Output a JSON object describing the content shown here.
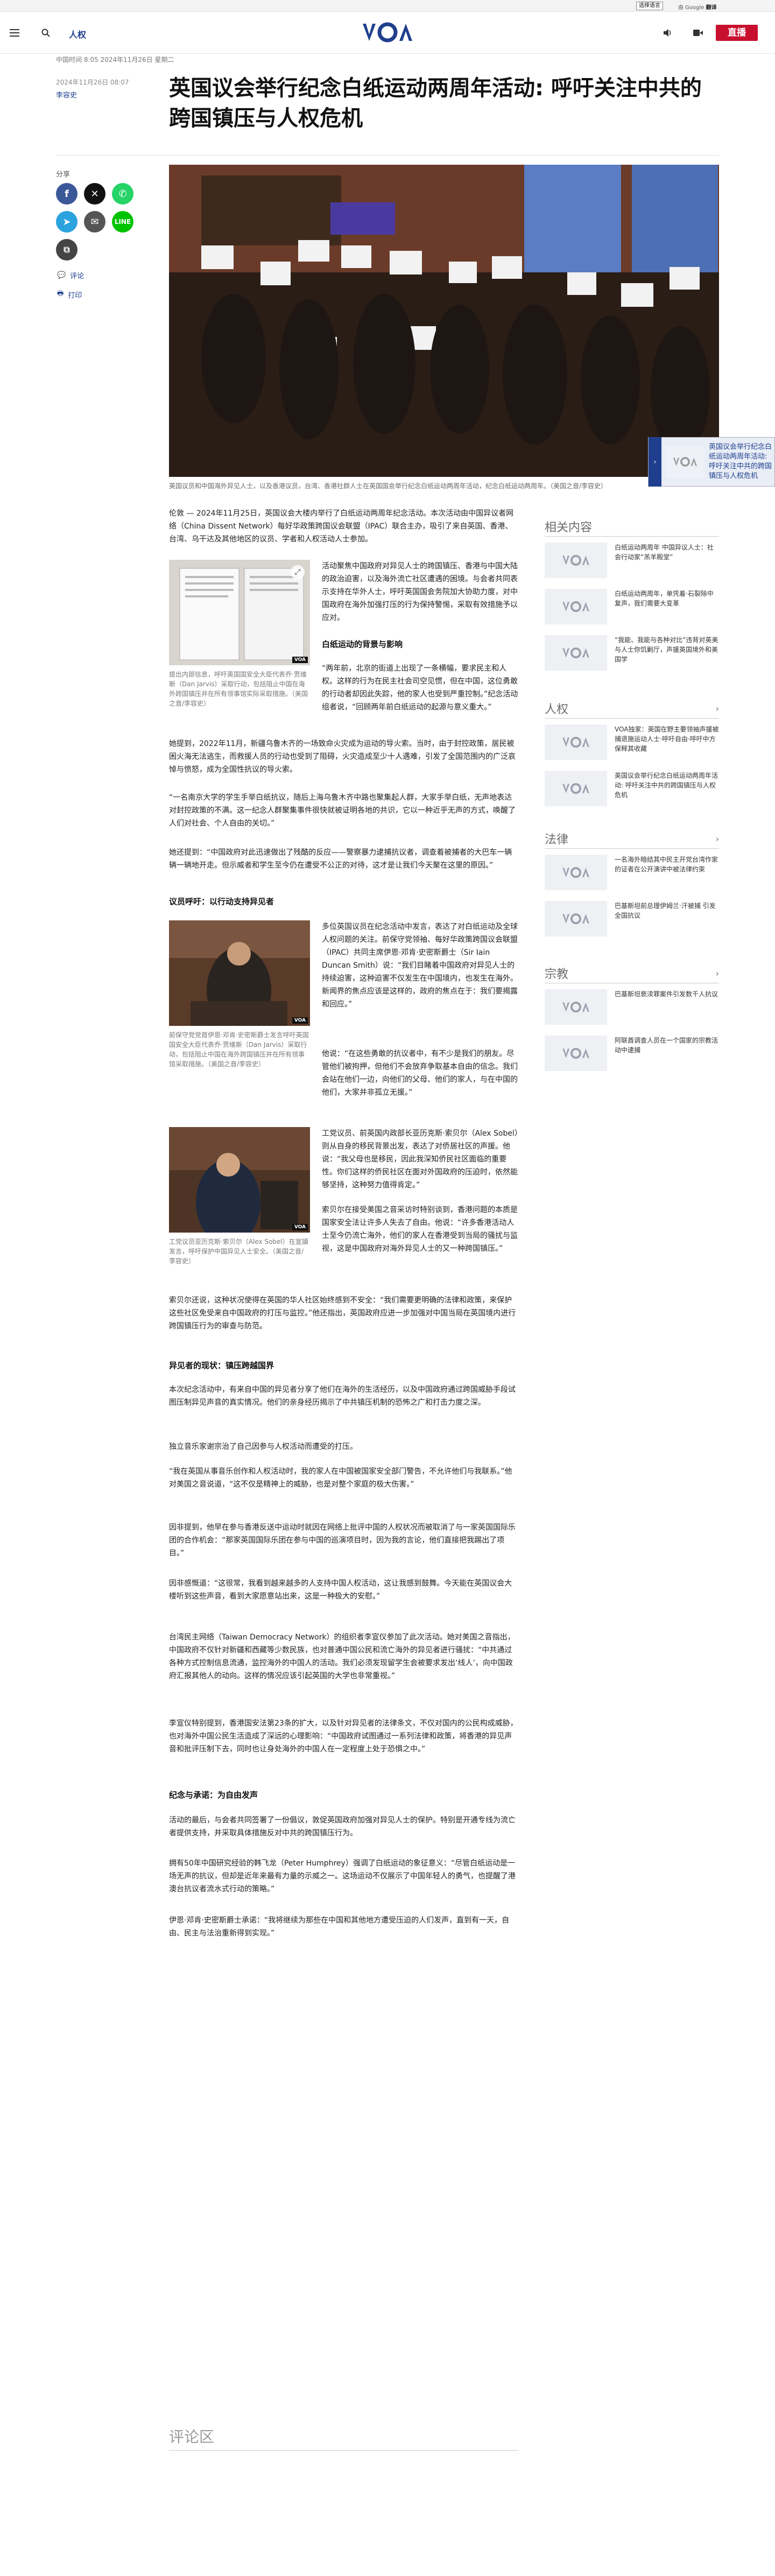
{
  "topbar": {
    "language_select": "选择语言",
    "powered_by": "由 Google",
    "translate": "翻译",
    "translate_suffix": "提供支持"
  },
  "header": {
    "nav_label": "人权",
    "logo_text": "VOA",
    "live_label": "直播",
    "live_color": "#c8102e"
  },
  "article": {
    "breadcrumb": "中国时间 8:05 2024年11月26日 星期二",
    "date": "2024年11月26日 08:07",
    "author": "李容史",
    "title": "英国议会举行纪念白纸运动两周年活动: 呼吁关注中共的跨国镇压与人权危机",
    "hero_caption": "英国议员和中国海外异见人士，以及香港议员，台湾、香港社群人士在英国国会举行纪念白纸运动两周年活动，纪念白纸运动两周年。（美国之音/李容史）",
    "share_label": "分享",
    "comment_link": "评论",
    "print_link": "打印",
    "paragraphs": [
      "伦敦 — 2024年11月25日，英国议会大楼内举行了白纸运动两周年纪念活动。本次活动由中国异议者网络（China Dissent Network）每好华政策跨国议会联盟（IPAC）联合主办，吸引了来自英国、香港、台湾、乌干达及其他地区的议员、学者和人权活动人士参加。",
      "活动聚焦中国政府对异见人士的跨国镇压、香港与中国大陆的政治迫害，以及海外流亡社区遭遇的困境。与会者共同表示支持在华外人士，呼吁英国国会务院加大协助力度，对中国政府在海外加强打压的行为保持警惕，采取有效措施予以应对。",
      "“两年前，北京的街道上出现了一条横幅，要求民主和人权。这样的行为在民主社会司空见惯，但在中国，这位勇敢的行动者却因此失踪，他的家人也受到严重控制。”纪念活动组者说，“回顾两年前白纸运动的起源与意义重大。”",
      "她提到，2022年11月，新疆乌鲁木齐的一场致命火灾成为运动的导火索。当时，由于封控政策，居民被困火海无法逃生，而救援人员的行动也受到了阻碍，火灾造成至少十人遇难，引发了全国范围内的广泛哀悼与愤怒，成为全国性抗议的导火索。",
      "“一名南京大学的学生手举白纸抗议，随后上海乌鲁木齐中路也聚集起人群，大家手举白纸，无声地表达对封控政策的不满。这一纪念人群聚集事件很快就被证明各地的共识，它以一种近乎无声的方式，唤醒了人们对社会、个人自由的关切。”",
      "她还提到：“中国政府对此迅速做出了残酷的反应——警察暴力逮捕抗议者，调查着被捕者的大巴车一辆辆一辆地开走。但示威者和学生至今仍在遭受不公正的对待，这才是让我们今天聚在这里的原因。”",
      "多位英国议员在纪念活动中发言，表达了对白纸运动及全球人权问题的关注。前保守党领袖、每好华政策跨国议会联盟（IPAC）共同主席伊恩·邓肯·史密斯爵士（Sir Iain Duncan Smith）说：“我们目睹着中国政府对异见人士的持续迫害，这种迫害不仅发生在中国境内，也发生在海外。新闻界的焦点应该是这样的，政府的焦点在于：我们要揭露和回应。”",
      "他说：“在这些勇敢的抗议者中，有不少是我们的朋友。尽管他们被拘押，但他们不会放弃争取基本自由的信念。我们会站在他们一边，向他们的父母、他们的家人，与在中国的他们，大家并非孤立无援。”",
      "工党议员、前英国内政部长亚历克斯·索贝尔（Alex Sobel）则从自身的移民背景出发，表达了对侨居社区的声援。他说：“我父母也是移民，因此我深知侨民社区面临的重要性。你们这样的侨民社区在面对外国政府的压迫时，依然能够坚持，这种努力值得肯定。”",
      "索贝尔在接受美国之音采访时特别谈到，香港问题的本质是国家安全法让许多人失去了自由。他说：“许多香港活动人士至今仍流亡海外，他们的家人在香港受到当局的骚扰与监视，这是中国政府对海外异见人士的又一种跨国镇压。”",
      "索贝尔还说，这种状况使得在英国的华人社区始终感到不安全：“我们需要更明确的法律和政策，来保护这些社区免受来自中国政府的打压与监控。”他还指出，英国政府应进一步加强对中国当局在英国境内进行跨国镇压行为的审查与防范。",
      "异见者的现状：镇压跨越国界",
      "本次纪念活动中，有来自中国的异见者分享了他们在海外的生活经历，以及中国政府通过跨国威胁手段试图压制异见声音的真实情况。他们的亲身经历揭示了中共镇压机制的恐怖之广和打击力度之深。",
      "独立音乐家谢宗治了自己因参与人权活动而遭受的打压。",
      "“我在英国从事音乐创作和人权活动时，我的家人在中国被国家安全部门警告，不允许他们与我联系。”他对美国之音说道，“这不仅是精神上的威胁，也是对整个家庭的极大伤害。”",
      "因非提到，他早在参与香港反送中运动时就因在网络上批评中国的人权状况而被取消了与一家英国国际乐团的合作机会：“那家英国国际乐团在参与中国的巡演项目时，因为我的言论，他们直接把我踢出了项目。”",
      "因非感慨道：“这很常，我看到越来越多的人支持中国人权活动，这让我感到鼓舞。今天能在英国议会大楼听到这些声音，看到大家愿意站出来，这是一种极大的安慰。”",
      "台湾民主网络（Taiwan Democracy Network）的组织者李宣仪参加了此次活动。她对美国之音指出，中国政府不仅针对新疆和西藏等少数民族，也对普通中国公民和流亡海外的异见者进行骚扰：“中共通过各种方式控制信息流通，监控海外的中国人的活动。我们必须发现留学生会被要求发出‘线人’，向中国政府汇报其他人的动向。这样的情况应该引起英国的大学也非常重视。”",
      "李宣仪特别提到，香港国安法第23条的扩大，以及针对异见者的法律条文，不仅对国内的公民构成威胁，也对海外中国公民生活造成了深远的心理影响：“中国政府试图通过一系列法律和政策，将香港的异见声音和批评压制下去，同时也让身处海外的中国人在一定程度上处于恐惧之中。”",
      "纪念与承诺：为自由发声",
      "活动的最后，与会者共同签署了一份倡议，敦促英国政府加强对异见人士的保护。特别是开通专线为流亡者提供支持，并采取具体措施反对中共的跨国镇压行为。",
      "拥有50年中国研究经验的韩飞龙（Peter Humphrey）强调了白纸运动的象征意义：“尽管白纸运动是一场无声的抗议，但却是近年来最有力量的示威之一。这场运动不仅展示了中国年轻人的勇气，也提醒了港澳台抗议者流水式行动的策略。”",
      "伊恩·邓肯·史密斯爵士承诺：“我将继续为那些在中国和其他地方遭受压迫的人们发声，直到有一天，自由、民主与法治重新得到实现。”"
    ],
    "subheads": [
      "白纸运动的背景与影响",
      "议员呼吁：以行动支持异见者"
    ],
    "inline_images": [
      {
        "caption": "提出内部信息，呼吁英国国安全大臣代表乔·贾维斯（Dan Jarvis）采取行动，包括阻止中国在海外跨国镇压并在所有领事馆实际采取措施。（美国之音/李容史）"
      },
      {
        "caption": "前保守党党首伊恩·邓肯·史密斯爵士发言呼吁英国国安全大臣代表乔·贾维斯（Dan Jarvis）采取行动，包括阻止中国在海外跨国镇压并在所有领事馆采取措施。（美国之音/李容史）"
      },
      {
        "caption": "工党议员亚历克斯·索贝尔（Alex Sobel）在宣讀发言，呼吁保护中国异见人士安全。（美国之音/李容史）"
      }
    ],
    "voa_tag": "VOA",
    "comments_heading": "评论区"
  },
  "floating_card": {
    "text": "英国议会举行纪念白纸运动两周年活动: 呼吁关注中共的跨国镇压与人权危机"
  },
  "rail": {
    "related_title": "相关内容",
    "related": [
      "白纸运动两周年 中国异议人士：社会行动家“羔羊殿堂”",
      "白纸运动两周年，单凭着·石裂除中复声，我们需要大变革",
      "“我能、我能与各种对比”违背对英美与人士你饥剿厅，声援英国境外和美国学"
    ],
    "human_rights_title": "人权",
    "human_rights": [
      "VOA独家：英国在野主要领袖声援被捕退施运动人士·呼吁自由·呼吁中方保释其收藏",
      "英国议会举行纪念白纸运动两周年活动: 呼吁关注中共的跨国镇压与人权危机"
    ],
    "law_title": "法律",
    "law": [
      "一名海外暗结其中民主开党台湾作家的证者在公开演讲中被法律约束",
      "巴基斯坦前总理伊姆兰·汗被捕 引发全国抗议"
    ],
    "religion_title": "宗教",
    "religion": [
      "巴基斯坦亵渎罪案件引发数千人抗议",
      "阿联酋调查人员在一个国家的宗教活动中逮捕"
    ]
  }
}
